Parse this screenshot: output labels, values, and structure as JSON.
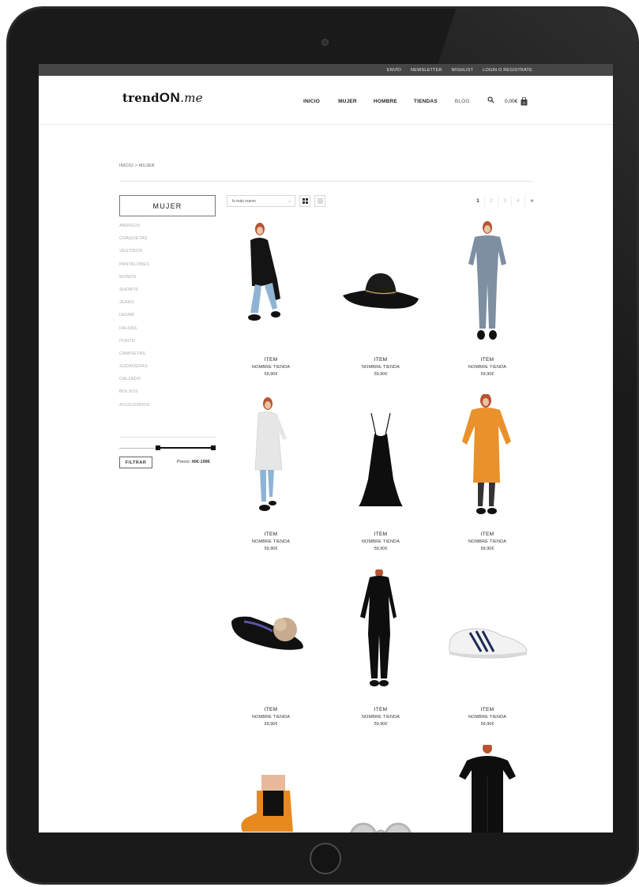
{
  "topbar": {
    "links": [
      "ENVÍO",
      "NEWSLETTER",
      "WISHLIST",
      "LOGIN O REGISTRATE"
    ]
  },
  "header": {
    "logo_main": "trend",
    "logo_on": "ON",
    "logo_suffix": ".me",
    "nav": [
      "INICIO",
      "MUJER",
      "HOMBRE",
      "TIENDAS",
      "BLOG"
    ],
    "cart_total": "0,00€",
    "cart_count": "0"
  },
  "breadcrumb": "INICIO > MUJER",
  "sidebar": {
    "category_title": "MUJER",
    "categories": [
      "ABRIGOS",
      "CHAQUETAS",
      "VESTIDOS",
      "PANTALONES",
      "MONOS",
      "SHORTS",
      "JEANS",
      "DENIM",
      "FALDAS",
      "PUNTO",
      "CAMISETAS",
      "SUDADERAS",
      "CALZADO",
      "BOLSOS",
      "ACCESORIOS"
    ],
    "filter_label": "FILTRAR",
    "price_prefix": "Precio:",
    "price_range": "40€-199€",
    "price_min_fraction": 0.4,
    "price_max_fraction": 1.0
  },
  "toolbar": {
    "sort_value": "lo más nuevo",
    "view_modes": [
      "grid-icon",
      "list-icon"
    ],
    "pages": [
      "1",
      "2",
      "3",
      "4",
      "»"
    ],
    "current_page": "1"
  },
  "products": [
    {
      "title": "ITEM",
      "store": "NOMBRE TIENDA",
      "price": "59,90€",
      "image": "woman-black-coat"
    },
    {
      "title": "ITEM",
      "store": "NOMBRE TIENDA",
      "price": "59,90€",
      "image": "black-hat"
    },
    {
      "title": "ITEM",
      "store": "NOMBRE TIENDA",
      "price": "59,90€",
      "image": "grey-jumpsuit"
    },
    {
      "title": "ITEM",
      "store": "NOMBRE TIENDA",
      "price": "59,90€",
      "image": "white-cardigan"
    },
    {
      "title": "ITEM",
      "store": "NOMBRE TIENDA",
      "price": "59,90€",
      "image": "black-slip-dress"
    },
    {
      "title": "ITEM",
      "store": "NOMBRE TIENDA",
      "price": "59,90€",
      "image": "orange-knit-dress"
    },
    {
      "title": "ITEM",
      "store": "NOMBRE TIENDA",
      "price": "59,90€",
      "image": "pompom-flat-shoe"
    },
    {
      "title": "ITEM",
      "store": "NOMBRE TIENDA",
      "price": "59,90€",
      "image": "black-jumpsuit"
    },
    {
      "title": "ITEM",
      "store": "NOMBRE TIENDA",
      "price": "59,90€",
      "image": "white-sneaker"
    }
  ],
  "partial_products": [
    "orange-ankle-boot",
    "round-sunglasses",
    "black-dress"
  ],
  "colors": {
    "topbar": "#464646",
    "text": "#222222",
    "muted": "#aaaaaa",
    "orange": "#e9912a"
  }
}
